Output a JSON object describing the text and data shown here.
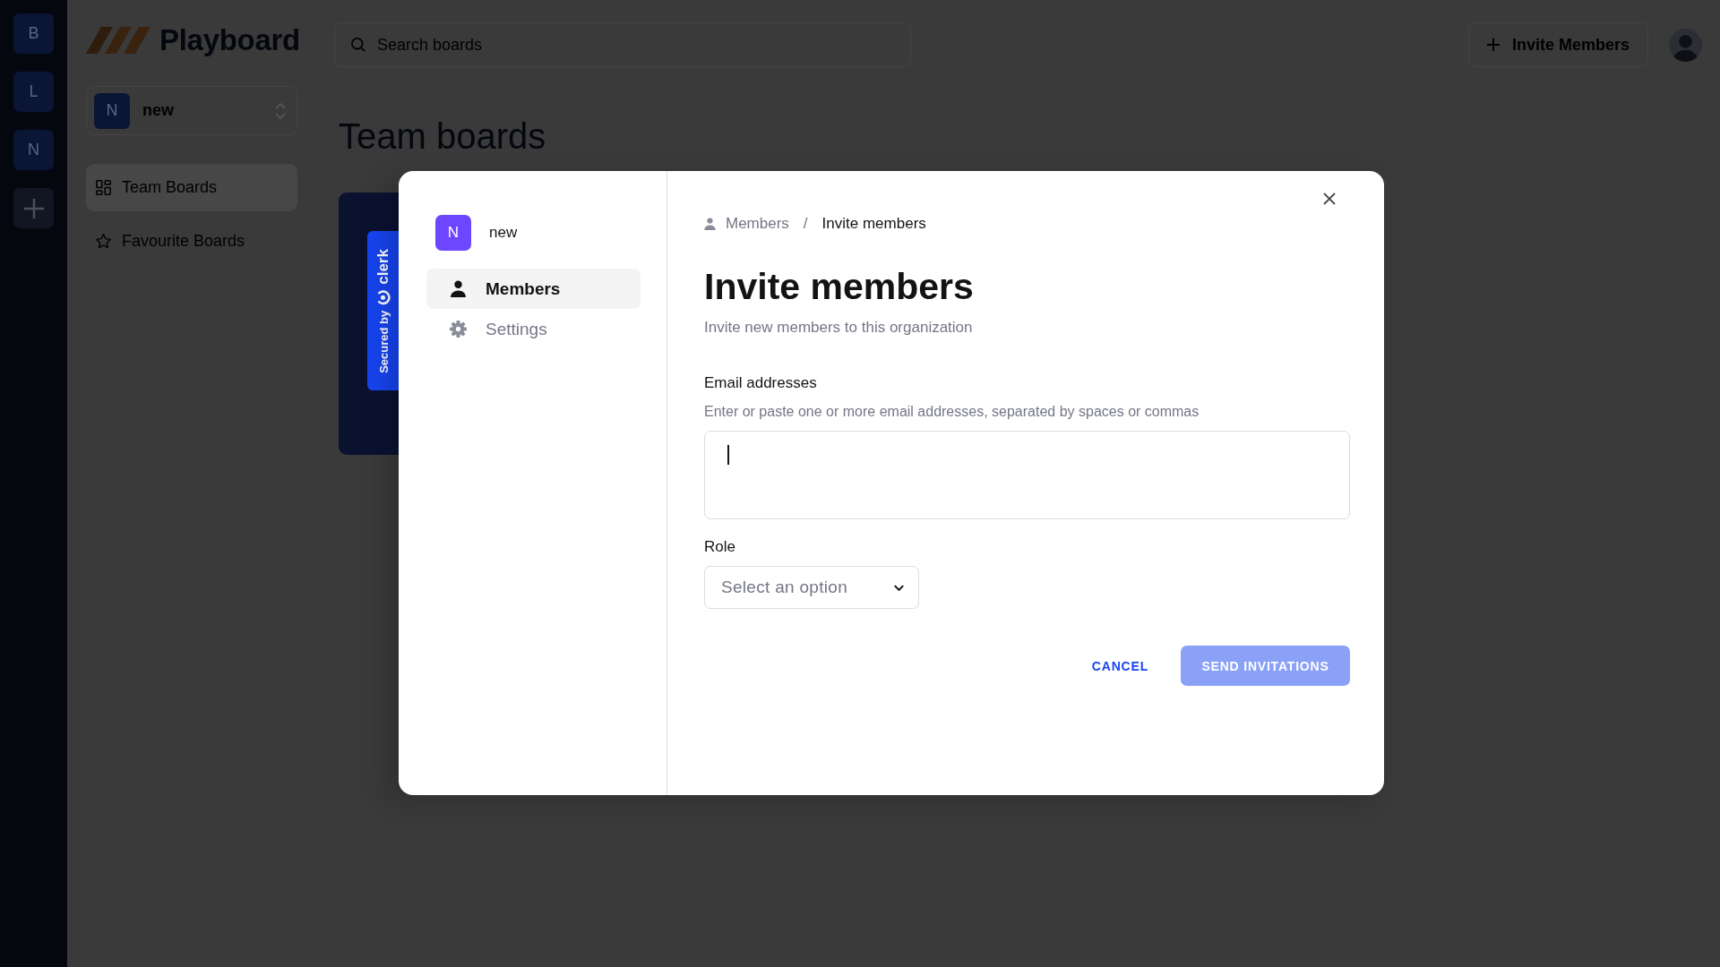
{
  "org_rail": [
    {
      "initial": "B"
    },
    {
      "initial": "L"
    },
    {
      "initial": "N"
    }
  ],
  "brand": {
    "name": "Playboard"
  },
  "org_switcher": {
    "initial": "N",
    "name": "new"
  },
  "sidebar": {
    "items": [
      {
        "label": "Team Boards",
        "kind": "team",
        "selected": true
      },
      {
        "label": "Favourite Boards",
        "kind": "favourite",
        "selected": false
      }
    ]
  },
  "search": {
    "placeholder": "Search boards"
  },
  "invite_button": {
    "label": "Invite Members"
  },
  "page_title": "Team boards",
  "modal": {
    "badge": {
      "text": "Secured by",
      "brand": "clerk"
    },
    "organization": {
      "initial": "N",
      "name": "new"
    },
    "nav": [
      {
        "label": "Members",
        "kind": "members",
        "selected": true
      },
      {
        "label": "Settings",
        "kind": "settings",
        "selected": false
      }
    ],
    "breadcrumb": {
      "items": [
        "Members",
        "Invite members"
      ],
      "separator": "/"
    },
    "title": "Invite members",
    "subtitle": "Invite new members to this organization",
    "email_field": {
      "label": "Email addresses",
      "hint": "Enter or paste one or more email addresses, separated by spaces or commas",
      "focused": true
    },
    "role_field": {
      "label": "Role",
      "placeholder": "Select an option"
    },
    "buttons": [
      {
        "label": "CANCEL",
        "kind": "text",
        "disabled": false
      },
      {
        "label": "SEND INVITATIONS",
        "kind": "primary",
        "disabled": true
      }
    ]
  }
}
